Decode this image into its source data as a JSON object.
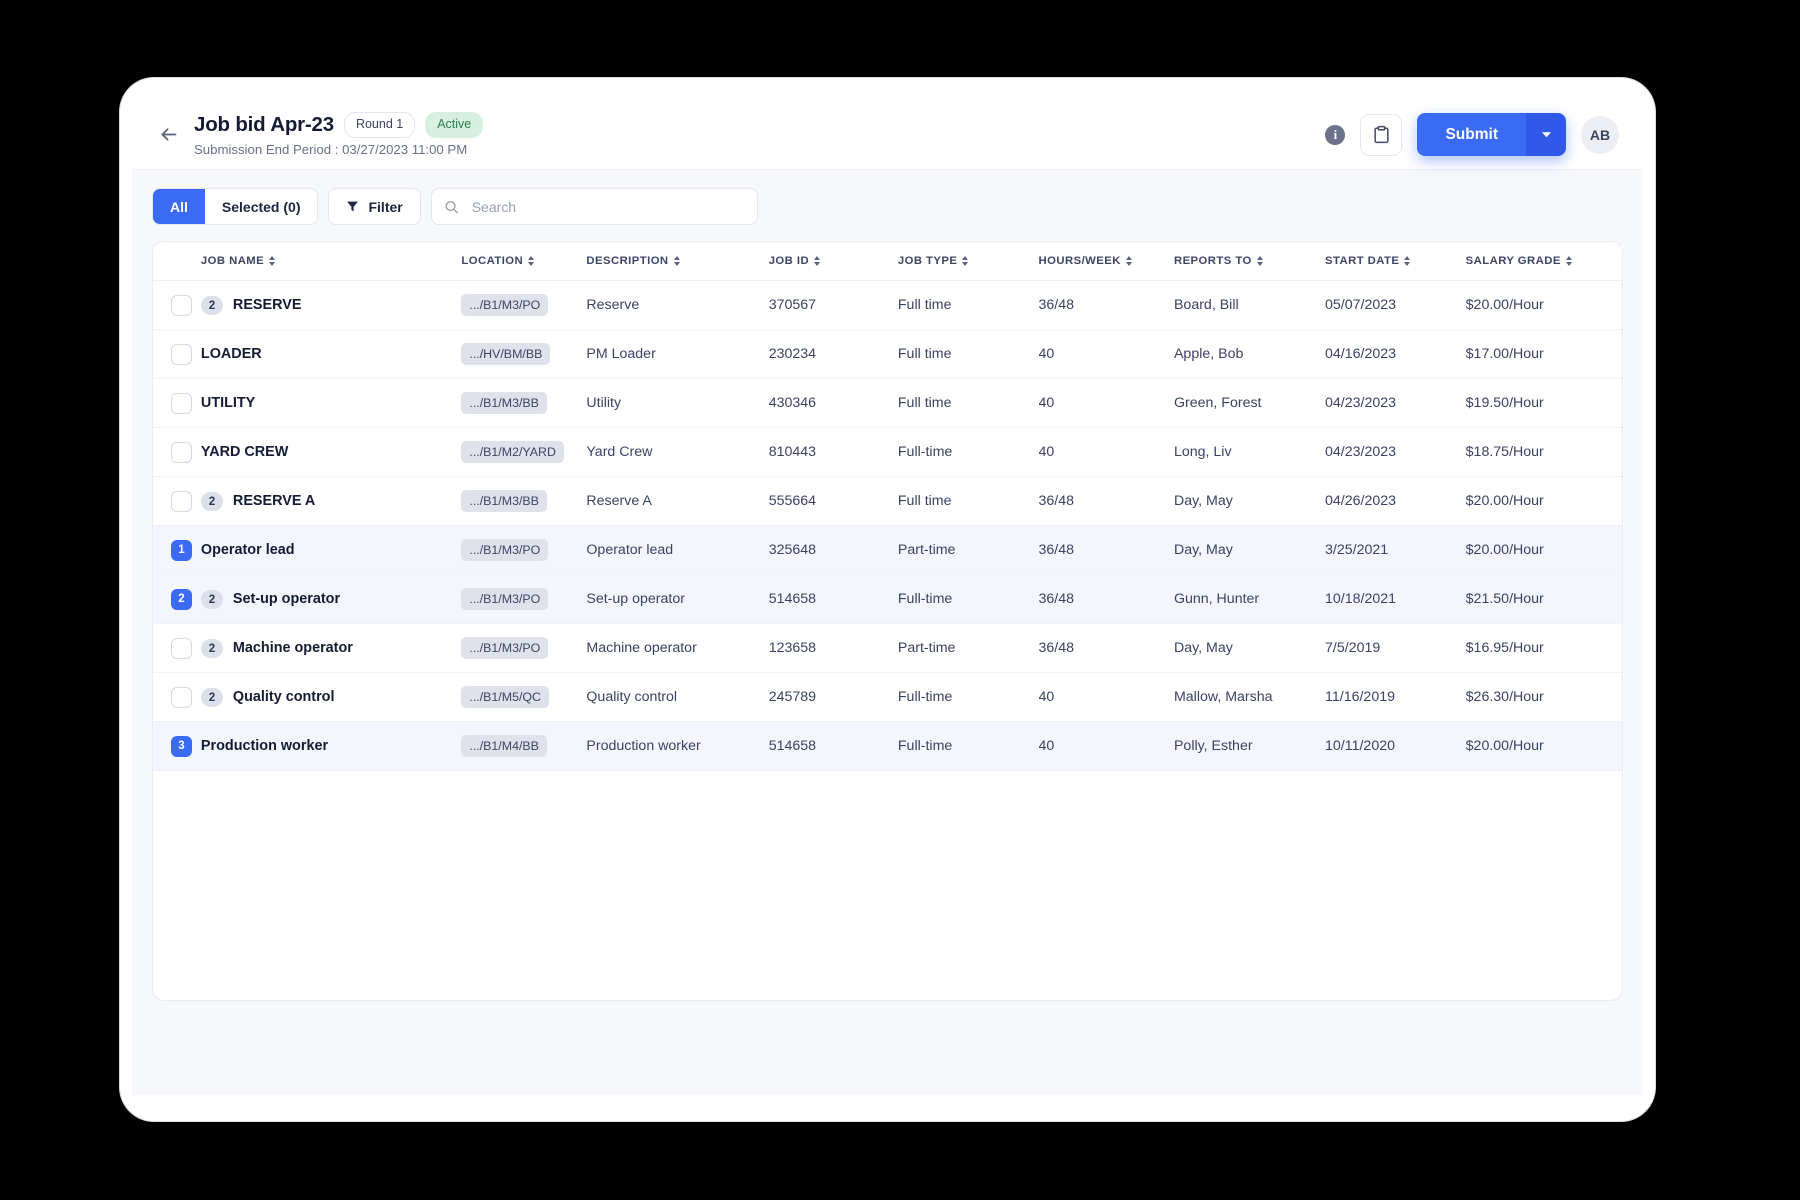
{
  "header": {
    "back_icon": "arrow-left-icon",
    "title": "Job bid Apr-23",
    "round_chip": "Round 1",
    "status_chip": "Active",
    "submission_period": "Submission End Period : 03/27/2023 11:00 PM",
    "info_icon": "info-icon",
    "info_glyph": "i",
    "clipboard_icon": "clipboard-icon",
    "submit_label": "Submit",
    "submit_dropdown_icon": "chevron-down-icon",
    "avatar_initials": "AB",
    "accent_color": "#3b6bf5",
    "status_chip_bg": "#d8f0e0",
    "status_chip_color": "#2f7d54"
  },
  "toolbar": {
    "tab_all": "All",
    "tab_selected": "Selected (0)",
    "filter_label": "Filter",
    "filter_icon": "funnel-icon",
    "search_icon": "search-icon",
    "search_value": "",
    "search_placeholder": "Search"
  },
  "table": {
    "columns": [
      {
        "key": "name",
        "label": "JOB NAME"
      },
      {
        "key": "loc",
        "label": "LOCATION"
      },
      {
        "key": "desc",
        "label": "DESCRIPTION"
      },
      {
        "key": "jobid",
        "label": "JOB ID"
      },
      {
        "key": "type",
        "label": "JOB TYPE"
      },
      {
        "key": "hours",
        "label": "HOURS/WEEK"
      },
      {
        "key": "rep",
        "label": "REPORTS TO"
      },
      {
        "key": "start",
        "label": "START DATE"
      },
      {
        "key": "sal",
        "label": "SALARY GRADE"
      }
    ],
    "rows": [
      {
        "selected": false,
        "rank": "",
        "count": "2",
        "name": "RESERVE",
        "loc": ".../B1/M3/PO",
        "desc": "Reserve",
        "jobid": "370567",
        "type": "Full time",
        "hours": "36/48",
        "rep": "Board, Bill",
        "start": "05/07/2023",
        "sal": "$20.00/Hour"
      },
      {
        "selected": false,
        "rank": "",
        "count": "",
        "name": "LOADER",
        "loc": ".../HV/BM/BB",
        "desc": "PM Loader",
        "jobid": "230234",
        "type": "Full time",
        "hours": "40",
        "rep": "Apple, Bob",
        "start": "04/16/2023",
        "sal": "$17.00/Hour"
      },
      {
        "selected": false,
        "rank": "",
        "count": "",
        "name": "UTILITY",
        "loc": ".../B1/M3/BB",
        "desc": "Utility",
        "jobid": "430346",
        "type": "Full time",
        "hours": "40",
        "rep": "Green, Forest",
        "start": "04/23/2023",
        "sal": "$19.50/Hour"
      },
      {
        "selected": false,
        "rank": "",
        "count": "",
        "name": "YARD CREW",
        "loc": ".../B1/M2/YARD",
        "desc": "Yard Crew",
        "jobid": "810443",
        "type": "Full-time",
        "hours": "40",
        "rep": "Long, Liv",
        "start": "04/23/2023",
        "sal": "$18.75/Hour"
      },
      {
        "selected": false,
        "rank": "",
        "count": "2",
        "name": "RESERVE A",
        "loc": ".../B1/M3/BB",
        "desc": "Reserve A",
        "jobid": "555664",
        "type": "Full time",
        "hours": "36/48",
        "rep": "Day, May",
        "start": "04/26/2023",
        "sal": "$20.00/Hour"
      },
      {
        "selected": true,
        "rank": "1",
        "count": "",
        "name": "Operator lead",
        "loc": ".../B1/M3/PO",
        "desc": "Operator lead",
        "jobid": "325648",
        "type": "Part-time",
        "hours": "36/48",
        "rep": "Day, May",
        "start": "3/25/2021",
        "sal": "$20.00/Hour"
      },
      {
        "selected": true,
        "rank": "2",
        "count": "2",
        "name": "Set-up operator",
        "loc": ".../B1/M3/PO",
        "desc": "Set-up operator",
        "jobid": "514658",
        "type": "Full-time",
        "hours": "36/48",
        "rep": "Gunn, Hunter",
        "start": "10/18/2021",
        "sal": "$21.50/Hour"
      },
      {
        "selected": false,
        "rank": "",
        "count": "2",
        "name": "Machine operator",
        "loc": ".../B1/M3/PO",
        "desc": "Machine operator",
        "jobid": "123658",
        "type": "Part-time",
        "hours": "36/48",
        "rep": "Day, May",
        "start": "7/5/2019",
        "sal": "$16.95/Hour"
      },
      {
        "selected": false,
        "rank": "",
        "count": "2",
        "name": "Quality control",
        "loc": ".../B1/M5/QC",
        "desc": "Quality control",
        "jobid": "245789",
        "type": "Full-time",
        "hours": "40",
        "rep": "Mallow, Marsha",
        "start": "11/16/2019",
        "sal": "$26.30/Hour"
      },
      {
        "selected": true,
        "rank": "3",
        "count": "",
        "name": "Production worker",
        "loc": ".../B1/M4/BB",
        "desc": "Production worker",
        "jobid": "514658",
        "type": "Full-time",
        "hours": "40",
        "rep": "Polly, Esther",
        "start": "10/11/2020",
        "sal": "$20.00/Hour"
      }
    ]
  }
}
